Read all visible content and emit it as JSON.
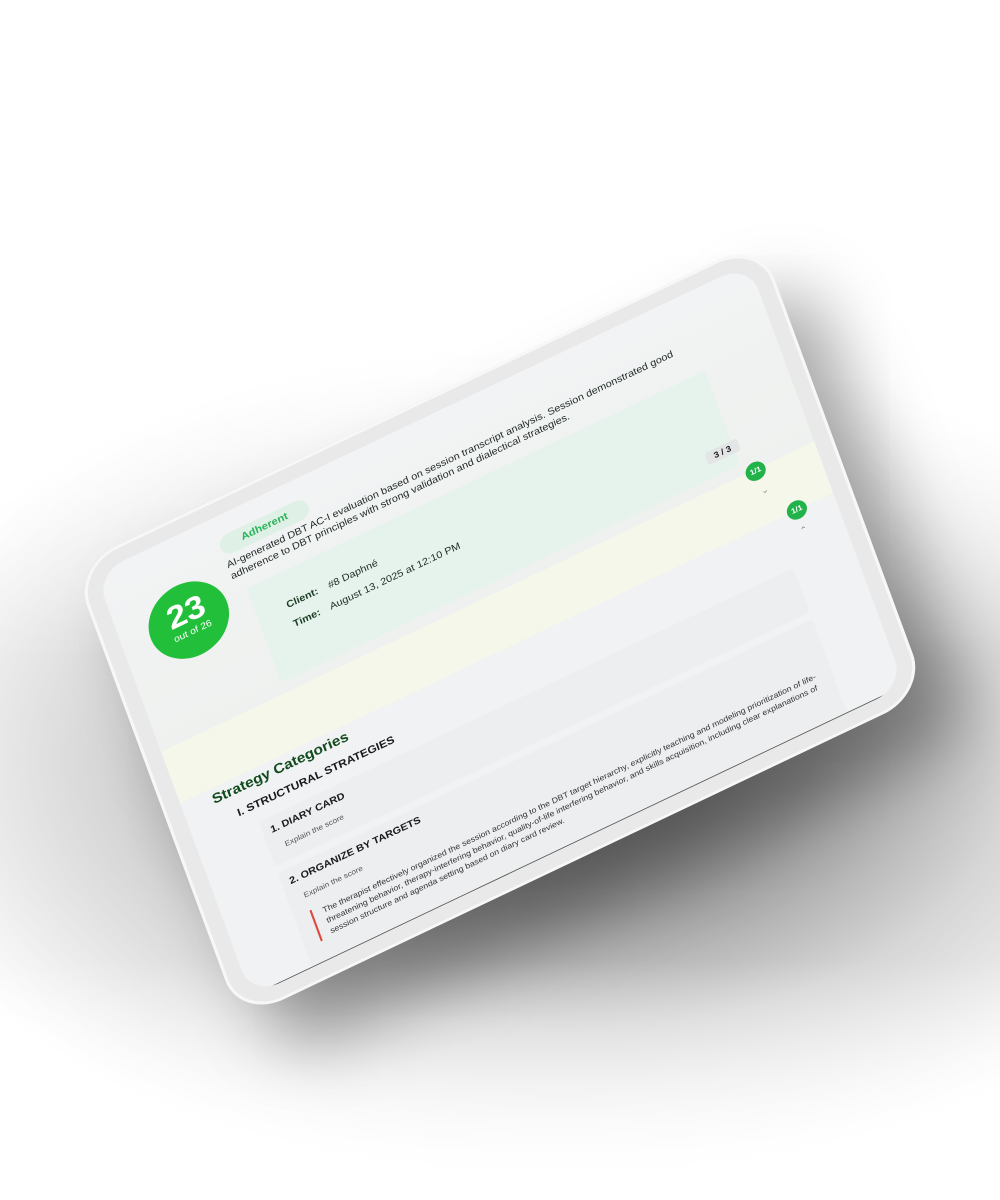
{
  "summary": {
    "score": "23",
    "score_total": "out of 26",
    "badge": "Adherent",
    "description": "AI-generated DBT AC-I evaluation based on session transcript analysis. Session demonstrated good adherence to DBT principles with strong validation and dialectical strategies.",
    "client_label": "Client:",
    "client_value": "#8 Daphné",
    "time_label": "Time:",
    "time_value": "August 13, 2025 at 12:10 PM"
  },
  "counter": "3 / 3",
  "items_scores": [
    "1/1",
    "1/1"
  ],
  "icons": {
    "collapse": "chevron-down-icon",
    "expand": "chevron-up-icon"
  },
  "strategies": {
    "title": "Strategy Categories",
    "category": "I. STRUCTURAL STRATEGIES",
    "items": [
      {
        "title": "1. DIARY CARD",
        "subtitle": "Explain the score"
      },
      {
        "title": "2. ORGANIZE BY TARGETS",
        "subtitle": "Explain the score",
        "explanation": "The therapist effectively organized the session according to the DBT target hierarchy, explicitly teaching and modeling prioritization of life-threatening behavior, therapy-interfering behavior, quality-of-life interfering behavior, and skills acquisition, including clear explanations of session structure and agenda setting based on diary card review."
      }
    ]
  },
  "colors": {
    "score_green": "#22c03a",
    "badge_bg": "#dff1e6",
    "title_green": "#114b1e",
    "accent_red": "#e0483f"
  }
}
